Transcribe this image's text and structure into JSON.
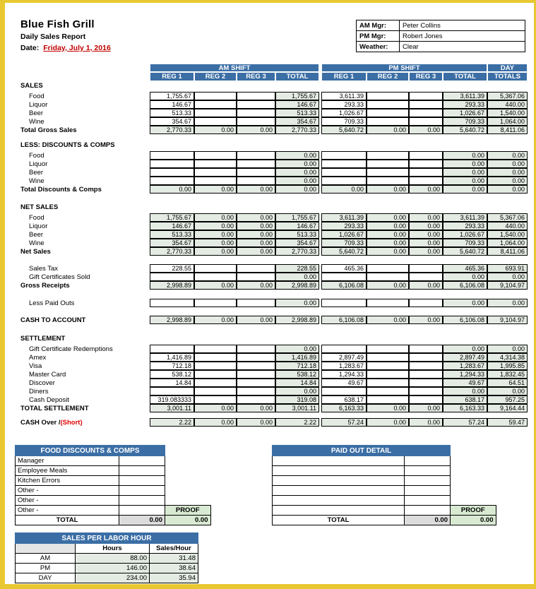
{
  "header": {
    "company": "Blue Fish Grill",
    "report_title": "Daily Sales Report",
    "date_label": "Date:",
    "date_value": "Friday, July 1, 2016",
    "info": [
      {
        "label": "AM Mgr:",
        "value": "Peter Collins"
      },
      {
        "label": "PM Mgr:",
        "value": "Robert Jones"
      },
      {
        "label": "Weather:",
        "value": "Clear"
      }
    ]
  },
  "columns": {
    "am_group": "AM SHIFT",
    "pm_group": "PM SHIFT",
    "day_group_line1": "DAY",
    "day_group_line2": "TOTALS",
    "reg1": "REG 1",
    "reg2": "REG 2",
    "reg3": "REG 3",
    "total": "TOTAL"
  },
  "sections": {
    "sales": {
      "title": "SALES",
      "rows": [
        {
          "label": "Food",
          "am": [
            "1,755.67",
            "",
            ""
          ],
          "am_total": "1,755.67",
          "pm": [
            "3,611.39",
            "",
            ""
          ],
          "pm_total": "3,611.39",
          "day": "5,367.06"
        },
        {
          "label": "Liquor",
          "am": [
            "146.67",
            "",
            ""
          ],
          "am_total": "146.67",
          "pm": [
            "293.33",
            "",
            ""
          ],
          "pm_total": "293.33",
          "day": "440.00"
        },
        {
          "label": "Beer",
          "am": [
            "513.33",
            "",
            ""
          ],
          "am_total": "513.33",
          "pm": [
            "1,026.67",
            "",
            ""
          ],
          "pm_total": "1,026.67",
          "day": "1,540.00"
        },
        {
          "label": "Wine",
          "am": [
            "354.67",
            "",
            ""
          ],
          "am_total": "354.67",
          "pm": [
            "709.33",
            "",
            ""
          ],
          "pm_total": "709.33",
          "day": "1,064.00"
        }
      ],
      "total_row": {
        "label": "Total Gross Sales",
        "am": [
          "2,770.33",
          "0.00",
          "0.00"
        ],
        "am_total": "2,770.33",
        "pm": [
          "5,640.72",
          "0.00",
          "0.00"
        ],
        "pm_total": "5,640.72",
        "day": "8,411.06"
      }
    },
    "discounts": {
      "title": "LESS: DISCOUNTS & COMPS",
      "rows": [
        {
          "label": "Food",
          "am": [
            "",
            "",
            ""
          ],
          "am_total": "0.00",
          "pm": [
            "",
            "",
            ""
          ],
          "pm_total": "0.00",
          "day": "0.00"
        },
        {
          "label": "Liquor",
          "am": [
            "",
            "",
            ""
          ],
          "am_total": "0.00",
          "pm": [
            "",
            "",
            ""
          ],
          "pm_total": "0.00",
          "day": "0.00"
        },
        {
          "label": "Beer",
          "am": [
            "",
            "",
            ""
          ],
          "am_total": "0.00",
          "pm": [
            "",
            "",
            ""
          ],
          "pm_total": "0.00",
          "day": "0.00"
        },
        {
          "label": "Wine",
          "am": [
            "",
            "",
            ""
          ],
          "am_total": "0.00",
          "pm": [
            "",
            "",
            ""
          ],
          "pm_total": "0.00",
          "day": "0.00"
        }
      ],
      "total_row": {
        "label": "Total Discounts & Comps",
        "am": [
          "0.00",
          "0.00",
          "0.00"
        ],
        "am_total": "0.00",
        "pm": [
          "0.00",
          "0.00",
          "0.00"
        ],
        "pm_total": "0.00",
        "day": "0.00"
      }
    },
    "net_sales": {
      "title": "NET SALES",
      "rows": [
        {
          "label": "Food",
          "am": [
            "1,755.67",
            "0.00",
            "0.00"
          ],
          "am_total": "1,755.67",
          "pm": [
            "3,611.39",
            "0.00",
            "0.00"
          ],
          "pm_total": "3,611.39",
          "day": "5,367.06"
        },
        {
          "label": "Liquor",
          "am": [
            "146.67",
            "0.00",
            "0.00"
          ],
          "am_total": "146.67",
          "pm": [
            "293.33",
            "0.00",
            "0.00"
          ],
          "pm_total": "293.33",
          "day": "440.00"
        },
        {
          "label": "Beer",
          "am": [
            "513.33",
            "0.00",
            "0.00"
          ],
          "am_total": "513.33",
          "pm": [
            "1,026.67",
            "0.00",
            "0.00"
          ],
          "pm_total": "1,026.67",
          "day": "1,540.00"
        },
        {
          "label": "Wine",
          "am": [
            "354.67",
            "0.00",
            "0.00"
          ],
          "am_total": "354.67",
          "pm": [
            "709.33",
            "0.00",
            "0.00"
          ],
          "pm_total": "709.33",
          "day": "1,064.00"
        }
      ],
      "total_row": {
        "label": "Net Sales",
        "am": [
          "2,770.33",
          "0.00",
          "0.00"
        ],
        "am_total": "2,770.33",
        "pm": [
          "5,640.72",
          "0.00",
          "0.00"
        ],
        "pm_total": "5,640.72",
        "day": "8,411.06"
      }
    },
    "receipts": {
      "rows": [
        {
          "label": "Sales Tax",
          "am": [
            "228.55",
            "",
            ""
          ],
          "am_total": "228.55",
          "pm": [
            "465.36",
            "",
            ""
          ],
          "pm_total": "465.36",
          "day": "693.91"
        },
        {
          "label": "Gift Certificates Sold",
          "am": [
            "",
            "",
            ""
          ],
          "am_total": "0.00",
          "pm": [
            "",
            "",
            ""
          ],
          "pm_total": "0.00",
          "day": "0.00"
        }
      ],
      "total_row": {
        "label": "Gross Receipts",
        "am": [
          "2,998.89",
          "0.00",
          "0.00"
        ],
        "am_total": "2,998.89",
        "pm": [
          "6,106.08",
          "0.00",
          "0.00"
        ],
        "pm_total": "6,106.08",
        "day": "9,104.97"
      },
      "paid_outs": {
        "label": "Less Paid Outs",
        "am": [
          "",
          "",
          ""
        ],
        "am_total": "0.00",
        "pm": [
          "",
          "",
          ""
        ],
        "pm_total": "0.00",
        "day": "0.00"
      },
      "cash_to_account": {
        "label": "CASH TO ACCOUNT",
        "am": [
          "2,998.89",
          "0.00",
          "0.00"
        ],
        "am_total": "2,998.89",
        "pm": [
          "6,106.08",
          "0.00",
          "0.00"
        ],
        "pm_total": "6,106.08",
        "day": "9,104.97"
      }
    },
    "settlement": {
      "title": "SETTLEMENT",
      "rows": [
        {
          "label": "Gift Certificate Redemptions",
          "am": [
            "",
            "",
            ""
          ],
          "am_total": "0.00",
          "pm": [
            "",
            "",
            ""
          ],
          "pm_total": "0.00",
          "day": "0.00"
        },
        {
          "label": "Amex",
          "am": [
            "1,416.89",
            "",
            ""
          ],
          "am_total": "1,416.89",
          "pm": [
            "2,897.49",
            "",
            ""
          ],
          "pm_total": "2,897.49",
          "day": "4,314.38"
        },
        {
          "label": "Visa",
          "am": [
            "712.18",
            "",
            ""
          ],
          "am_total": "712.18",
          "pm": [
            "1,283.67",
            "",
            ""
          ],
          "pm_total": "1,283.67",
          "day": "1,995.85"
        },
        {
          "label": "Master Card",
          "am": [
            "538.12",
            "",
            ""
          ],
          "am_total": "538.12",
          "pm": [
            "1,294.33",
            "",
            ""
          ],
          "pm_total": "1,294.33",
          "day": "1,832.45"
        },
        {
          "label": "Discover",
          "am": [
            "14.84",
            "",
            ""
          ],
          "am_total": "14.84",
          "pm": [
            "49.67",
            "",
            ""
          ],
          "pm_total": "49.67",
          "day": "64.51"
        },
        {
          "label": "Diners",
          "am": [
            "",
            "",
            ""
          ],
          "am_total": "0.00",
          "pm": [
            "",
            "",
            ""
          ],
          "pm_total": "0.00",
          "day": "0.00"
        },
        {
          "label": "Cash Deposit",
          "am": [
            "319.083333",
            "",
            ""
          ],
          "am_total": "319.08",
          "pm": [
            "638.17",
            "",
            ""
          ],
          "pm_total": "638.17",
          "day": "957.25"
        }
      ],
      "total_row": {
        "label": "TOTAL SETTLEMENT",
        "am": [
          "3,001.11",
          "0.00",
          "0.00"
        ],
        "am_total": "3,001.11",
        "pm": [
          "6,163.33",
          "0.00",
          "0.00"
        ],
        "pm_total": "6,163.33",
        "day": "9,164.44"
      }
    },
    "cash_over_short": {
      "label_black": "CASH Over /",
      "label_red": "(Short)",
      "am": [
        "2.22",
        "0.00",
        "0.00"
      ],
      "am_total": "2.22",
      "pm": [
        "57.24",
        "0.00",
        "0.00"
      ],
      "pm_total": "57.24",
      "day": "59.47"
    }
  },
  "food_discounts": {
    "title": "FOOD DISCOUNTS & COMPS",
    "rows": [
      {
        "label": "Manager",
        "value": ""
      },
      {
        "label": "Employee Meals",
        "value": ""
      },
      {
        "label": "Kitchen Errors",
        "value": ""
      },
      {
        "label": "Other -",
        "value": ""
      },
      {
        "label": "Other -",
        "value": ""
      },
      {
        "label": "Other -",
        "value": ""
      }
    ],
    "proof_label": "PROOF",
    "total_label": "TOTAL",
    "total_value": "0.00",
    "proof_value": "0.00"
  },
  "paid_out_detail": {
    "title": "PAID OUT DETAIL",
    "rows": [
      {
        "label": "",
        "value": ""
      },
      {
        "label": "",
        "value": ""
      },
      {
        "label": "",
        "value": ""
      },
      {
        "label": "",
        "value": ""
      },
      {
        "label": "",
        "value": ""
      },
      {
        "label": "",
        "value": ""
      }
    ],
    "proof_label": "PROOF",
    "total_label": "TOTAL",
    "total_value": "0.00",
    "proof_value": "0.00"
  },
  "sales_per_labor_hour": {
    "title": "SALES PER LABOR HOUR",
    "col_hours": "Hours",
    "col_sales_hour": "Sales/Hour",
    "rows": [
      {
        "label": "AM",
        "hours": "88.00",
        "sales_hour": "31.48"
      },
      {
        "label": "PM",
        "hours": "146.00",
        "sales_hour": "38.64"
      },
      {
        "label": "DAY",
        "hours": "234.00",
        "sales_hour": "35.94"
      }
    ]
  },
  "colors": {
    "banner_blue": "#3b6ea5",
    "cell_green": "#e3ebe2",
    "proof_green": "#d9ead3",
    "accent_red": "#c00000",
    "page_border": "#e8c832"
  }
}
